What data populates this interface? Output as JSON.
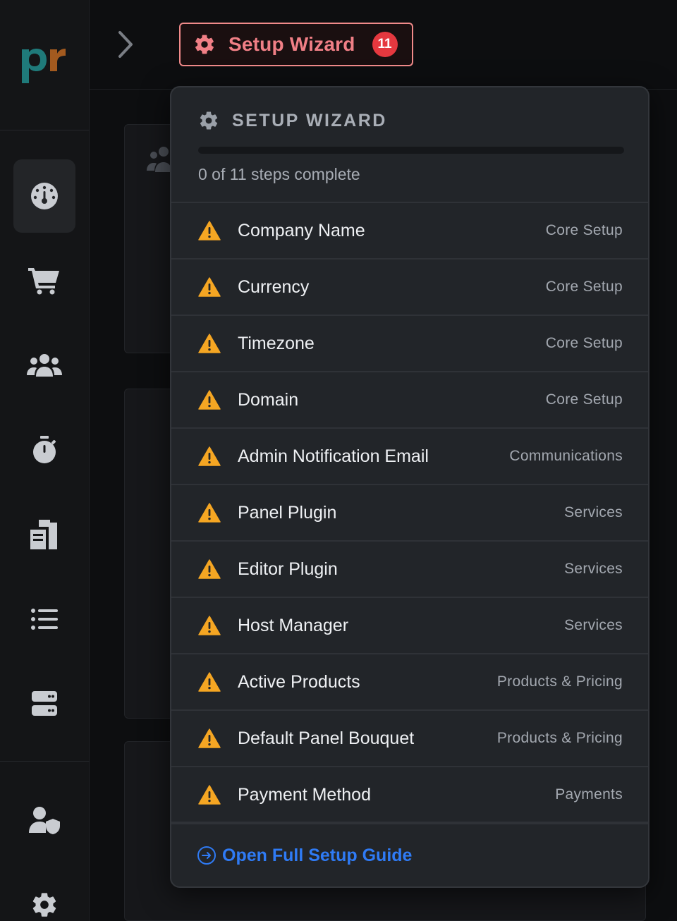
{
  "logo": {
    "text": "pr",
    "colors": {
      "p": "#1f7a7a",
      "r": "#a35a1f"
    }
  },
  "topbar": {
    "wizard_button": {
      "label": "Setup Wizard",
      "badge": "11",
      "color": "#f07f86"
    }
  },
  "sidebar": {
    "items": [
      {
        "icon": "dashboard-icon",
        "active": true
      },
      {
        "icon": "cart-icon",
        "active": false
      },
      {
        "icon": "users-icon",
        "active": false
      },
      {
        "icon": "stopwatch-icon",
        "active": false
      },
      {
        "icon": "invoices-icon",
        "active": false
      },
      {
        "icon": "list-icon",
        "active": false
      },
      {
        "icon": "server-icon",
        "active": false
      },
      {
        "icon": "admin-shield-icon",
        "active": false
      },
      {
        "icon": "gear-icon",
        "active": false
      }
    ]
  },
  "panel": {
    "title": "SETUP WIZARD",
    "progress": {
      "completed": 0,
      "total": 11,
      "text": "0 of 11 steps complete",
      "fraction": 0
    },
    "steps": [
      {
        "name": "Company Name",
        "category": "Core Setup"
      },
      {
        "name": "Currency",
        "category": "Core Setup"
      },
      {
        "name": "Timezone",
        "category": "Core Setup"
      },
      {
        "name": "Domain",
        "category": "Core Setup"
      },
      {
        "name": "Admin Notification Email",
        "category": "Communications"
      },
      {
        "name": "Panel Plugin",
        "category": "Services"
      },
      {
        "name": "Editor Plugin",
        "category": "Services"
      },
      {
        "name": "Host Manager",
        "category": "Services"
      },
      {
        "name": "Active Products",
        "category": "Products & Pricing"
      },
      {
        "name": "Default Panel Bouquet",
        "category": "Products & Pricing"
      },
      {
        "name": "Payment Method",
        "category": "Payments"
      }
    ],
    "footer_link": "Open Full Setup Guide",
    "warning_color": "#f5a623",
    "link_color": "#2f7bf5"
  }
}
